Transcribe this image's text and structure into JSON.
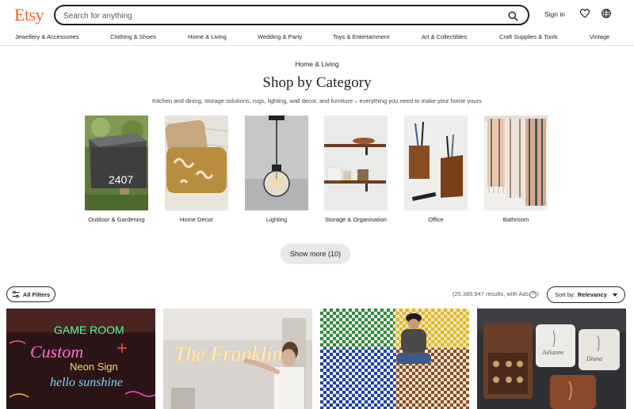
{
  "header": {
    "logo": "Etsy",
    "search_placeholder": "Search for anything",
    "signin": "Sign in"
  },
  "nav": [
    "Jewellery & Accessories",
    "Clothing & Shoes",
    "Home & Living",
    "Wedding & Party",
    "Toys & Entertainment",
    "Art & Collectibles",
    "Craft Supplies & Tools",
    "Vintage"
  ],
  "category_page": {
    "breadcrumb": "Home & Living",
    "title": "Shop by Category",
    "subtitle": "Kitchen and dining, storage solutions, rugs, lighting, wall decor, and furniture – everything you need to make your home yours",
    "categories": [
      {
        "label": "Outdoor & Gardening",
        "icon": "mailbox-photo"
      },
      {
        "label": "Home Decor",
        "icon": "pillows-photo"
      },
      {
        "label": "Lighting",
        "icon": "pendant-lamp-photo"
      },
      {
        "label": "Storage & Organisation",
        "icon": "wall-shelves-photo"
      },
      {
        "label": "Office",
        "icon": "pen-holders-photo"
      },
      {
        "label": "Bathroom",
        "icon": "towels-photo"
      }
    ],
    "show_more": "Show more (10)"
  },
  "results_bar": {
    "filters": "All Filters",
    "results": "(25,385,947 results, with Ads",
    "info": "?",
    "results_close": ")",
    "sort_prefix": "Sort by:",
    "sort_value": "Relevancy"
  },
  "listings": [
    {
      "neon_text": "GAME ROOM",
      "neon_text_2": "Custom",
      "neon_text_3": "hello sunshine",
      "neon_text_4": "Neon Sign"
    },
    {
      "neon_text": "The Franklins"
    },
    {
      "icon": "checkered-rug-photo"
    },
    {
      "icon": "jewelry-box-photo",
      "engraved_1": "Julianne",
      "engraved_2": "Diana"
    }
  ],
  "colors": {
    "brand": "#f1641e",
    "text": "#222222",
    "muted": "#595959",
    "pill_bg": "#e8e8e6"
  }
}
